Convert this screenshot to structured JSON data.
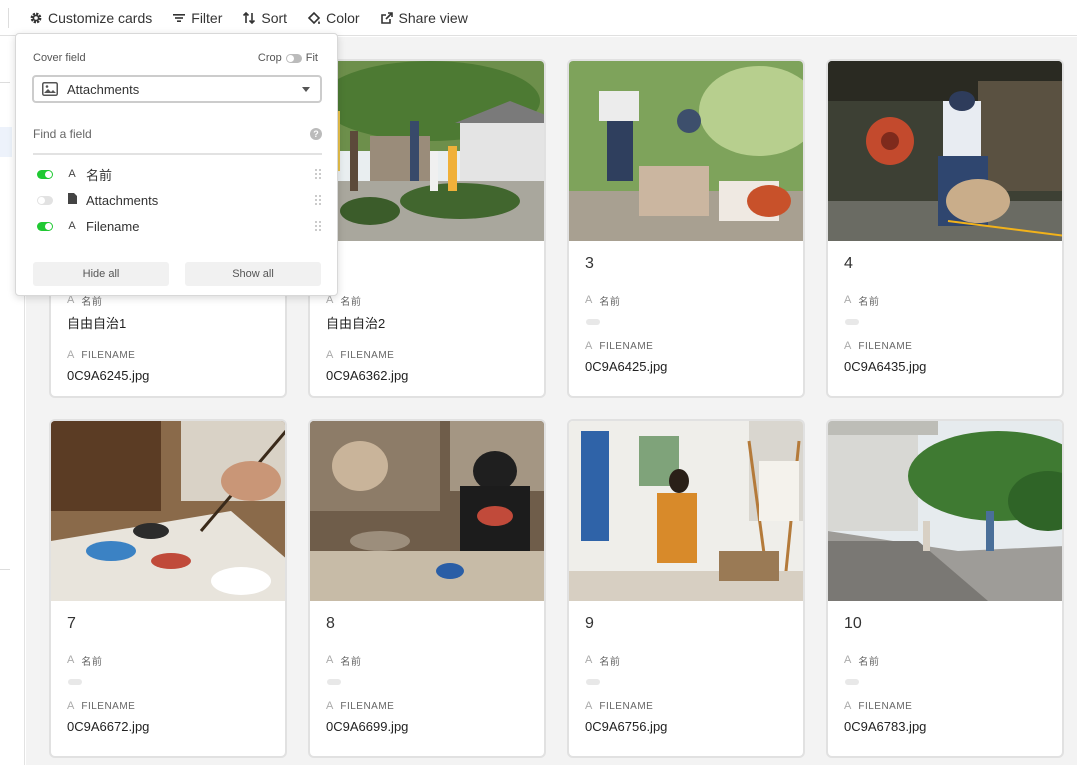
{
  "toolbar": {
    "customize_label": "Customize cards",
    "filter_label": "Filter",
    "sort_label": "Sort",
    "color_label": "Color",
    "share_label": "Share view"
  },
  "popover": {
    "cover_field_label": "Cover field",
    "crop_label": "Crop",
    "fit_label": "Fit",
    "cover_field_value": "Attachments",
    "find_placeholder": "Find a field",
    "fields": [
      {
        "name": "名前",
        "visible": true,
        "type_icon": "text-icon"
      },
      {
        "name": "Attachments",
        "visible": false,
        "type_icon": "attachment-icon"
      },
      {
        "name": "Filename",
        "visible": true,
        "type_icon": "text-icon"
      }
    ],
    "hide_all_label": "Hide all",
    "show_all_label": "Show all"
  },
  "field_labels": {
    "name": "名前",
    "filename": "FILENAME"
  },
  "cards": [
    {
      "title": "",
      "name": "自由自治1",
      "filename": "0C9A6245.jpg"
    },
    {
      "title": "",
      "name": "自由自治2",
      "filename": "0C9A6362.jpg"
    },
    {
      "title": "3",
      "name": "",
      "filename": "0C9A6425.jpg"
    },
    {
      "title": "4",
      "name": "",
      "filename": "0C9A6435.jpg"
    },
    {
      "title": "7",
      "name": "",
      "filename": "0C9A6672.jpg"
    },
    {
      "title": "8",
      "name": "",
      "filename": "0C9A6699.jpg"
    },
    {
      "title": "9",
      "name": "",
      "filename": "0C9A6756.jpg"
    },
    {
      "title": "10",
      "name": "",
      "filename": "0C9A6783.jpg"
    }
  ],
  "colors": {
    "toggle_on": "#20c933",
    "toggle_off": "#e2e2e2",
    "gallery_bg": "#f3f3f3"
  }
}
